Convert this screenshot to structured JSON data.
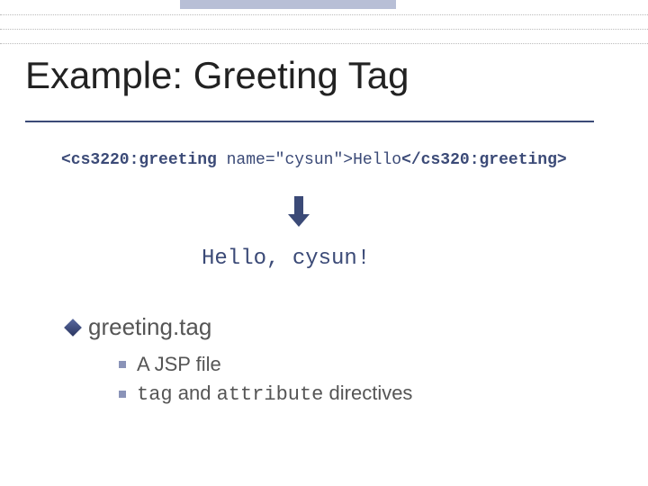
{
  "title": "Example: Greeting Tag",
  "code": {
    "open_tag_start": "<cs3220:greeting",
    "attr": " name=\"cysun\">",
    "body": "Hello",
    "close_tag": "</cs320:greeting>"
  },
  "output": "Hello, cysun!",
  "bullet_main": "greeting.tag",
  "sub_items": [
    "A JSP file",
    "tag and attribute directives"
  ]
}
